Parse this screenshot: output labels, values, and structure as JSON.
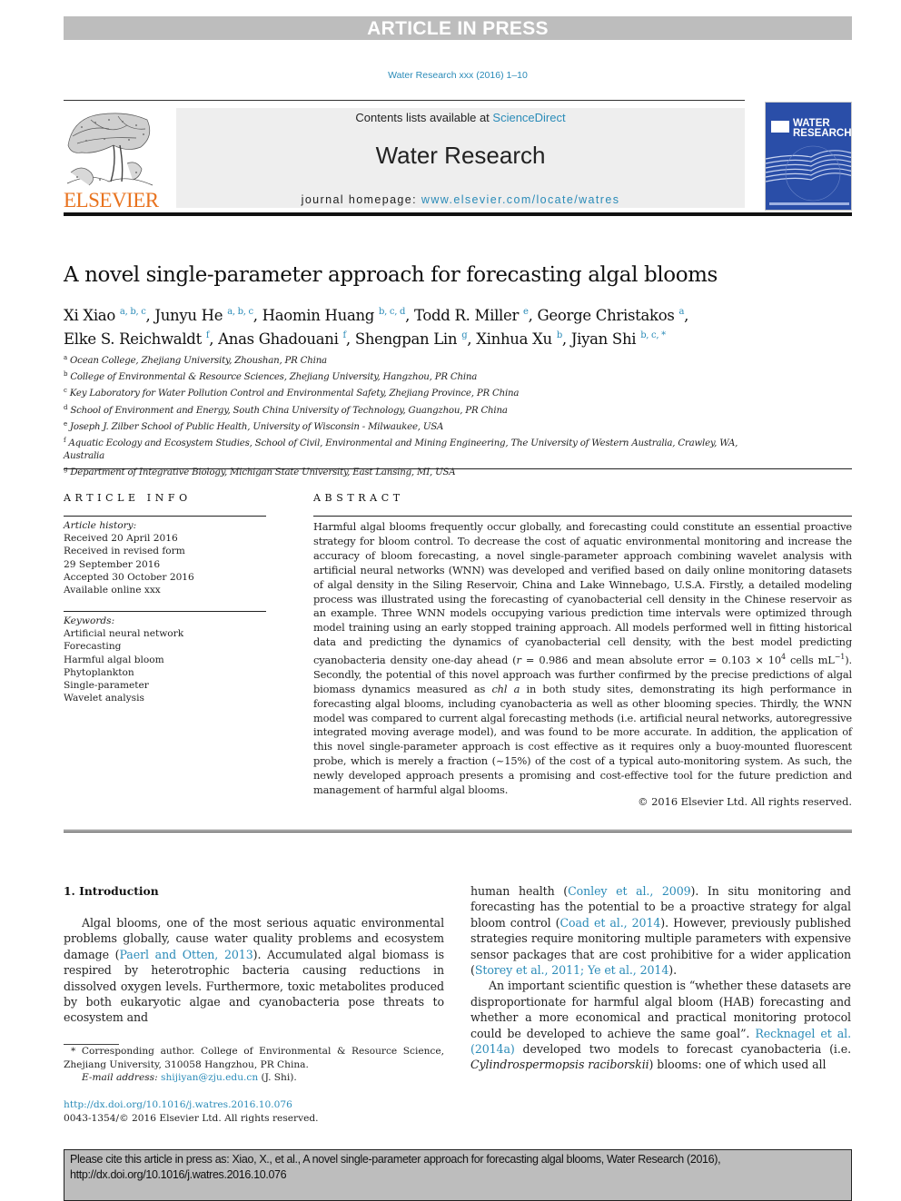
{
  "banner": {
    "text": "ARTICLE IN PRESS"
  },
  "journal_citation": "Water Research xxx (2016) 1–10",
  "masthead": {
    "publisher_logo_text": "ELSEVIER",
    "contents_prefix": "Contents lists available at ",
    "contents_link": "ScienceDirect",
    "journal_name": "Water Research",
    "homepage_prefix": "journal homepage: ",
    "homepage_link": "www.elsevier.com/locate/watres",
    "cover_title_line1": "WATER",
    "cover_title_line2": "RESEARCH"
  },
  "article": {
    "title": "A novel single-parameter approach for forecasting algal blooms",
    "authors": [
      {
        "name": "Xi Xiao",
        "sup": "a, b, c"
      },
      {
        "name": "Junyu He",
        "sup": "a, b, c"
      },
      {
        "name": "Haomin Huang",
        "sup": "b, c, d"
      },
      {
        "name": "Todd R. Miller",
        "sup": "e"
      },
      {
        "name": "George Christakos",
        "sup": "a"
      },
      {
        "name": "Elke S. Reichwaldt",
        "sup": "f"
      },
      {
        "name": "Anas Ghadouani",
        "sup": "f"
      },
      {
        "name": "Shengpan Lin",
        "sup": "g"
      },
      {
        "name": "Xinhua Xu",
        "sup": "b"
      },
      {
        "name": "Jiyan Shi",
        "sup": "b, c, *"
      }
    ],
    "affiliations": [
      {
        "key": "a",
        "text": "Ocean College, Zhejiang University, Zhoushan, PR China"
      },
      {
        "key": "b",
        "text": "College of Environmental & Resource Sciences, Zhejiang University, Hangzhou, PR China"
      },
      {
        "key": "c",
        "text": "Key Laboratory for Water Pollution Control and Environmental Safety, Zhejiang Province, PR China"
      },
      {
        "key": "d",
        "text": "School of Environment and Energy, South China University of Technology, Guangzhou, PR China"
      },
      {
        "key": "e",
        "text": "Joseph J. Zilber School of Public Health, University of Wisconsin - Milwaukee, USA"
      },
      {
        "key": "f",
        "text": "Aquatic Ecology and Ecosystem Studies, School of Civil, Environmental and Mining Engineering, The University of Western Australia, Crawley, WA, Australia"
      },
      {
        "key": "g",
        "text": "Department of Integrative Biology, Michigan State University, East Lansing, MI, USA"
      }
    ]
  },
  "article_info": {
    "heading": "ARTICLE INFO",
    "history_label": "Article history:",
    "history": [
      "Received 20 April 2016",
      "Received in revised form",
      "29 September 2016",
      "Accepted 30 October 2016",
      "Available online xxx"
    ],
    "keywords_label": "Keywords:",
    "keywords": [
      "Artificial neural network",
      "Forecasting",
      "Harmful algal bloom",
      "Phytoplankton",
      "Single-parameter",
      "Wavelet analysis"
    ]
  },
  "abstract": {
    "heading": "ABSTRACT",
    "part1": "Harmful algal blooms frequently occur globally, and forecasting could constitute an essential proactive strategy for bloom control. To decrease the cost of aquatic environmental monitoring and increase the accuracy of bloom forecasting, a novel single-parameter approach combining wavelet analysis with artificial neural networks (WNN) was developed and verified based on daily online monitoring datasets of algal density in the Siling Reservoir, China and Lake Winnebago, U.S.A. Firstly, a detailed modeling process was illustrated using the forecasting of cyanobacterial cell density in the Chinese reservoir as an example. Three WNN models occupying various prediction time intervals were optimized through model training using an early stopped training approach. All models performed well in fitting historical data and predicting the dynamics of cyanobacterial cell density, with the best model predicting cyanobacteria density one-day ahead (",
    "r_symbol": "r",
    "part2": " = 0.986 and mean absolute error = 0.103 × 10",
    "exp1": "4",
    "part3": " cells mL",
    "exp2": "−1",
    "part4": "). Secondly, the potential of this novel approach was further confirmed by the precise predictions of algal biomass dynamics measured as ",
    "chl": "chl a",
    "part5": " in both study sites, demonstrating its high performance in forecasting algal blooms, including cyanobacteria as well as other blooming species. Thirdly, the WNN model was compared to current algal forecasting methods (i.e. artificial neural networks, autoregressive integrated moving average model), and was found to be more accurate. In addition, the application of this novel single-parameter approach is cost effective as it requires only a buoy-mounted fluorescent probe, which is merely a fraction (~15%) of the cost of a typical auto-monitoring system. As such, the newly developed approach presents a promising and cost-effective tool for the future prediction and management of harmful algal blooms.",
    "copyright": "© 2016 Elsevier Ltd. All rights reserved."
  },
  "introduction": {
    "heading": "1.  Introduction",
    "p1_a": "Algal blooms, one of the most serious aquatic environmental problems globally, cause water quality problems and ecosystem damage (",
    "p1_ref1": "Paerl and Otten, 2013",
    "p1_b": "). Accumulated algal biomass is respired by heterotrophic bacteria causing reductions in dissolved oxygen levels. Furthermore, toxic metabolites produced by both eukaryotic algae and cyanobacteria pose threats to ecosystem and ",
    "p1_c": "human health (",
    "p1_ref2": "Conley et al., 2009",
    "p1_d": "). In situ monitoring and forecasting has the potential to be a proactive strategy for algal bloom control (",
    "p1_ref3": "Coad et al., 2014",
    "p1_e": "). However, previously published strategies require monitoring multiple parameters with expensive sensor packages that are cost prohibitive for a wider application (",
    "p1_ref4": "Storey et al., 2011; Ye et al., 2014",
    "p1_f": ").",
    "p2_a": "An important scientific question is “whether these datasets are disproportionate for harmful algal bloom (HAB) forecasting and whether a more economical and practical monitoring protocol could be developed to achieve the same goal”. ",
    "p2_ref1": "Recknagel et al. (2014a)",
    "p2_b": " developed two models to forecast cyanobacteria (i.e. ",
    "p2_species": "Cylindrospermopsis raciborskii",
    "p2_c": ") blooms: one of which used all"
  },
  "footnotes": {
    "corresponding": "* Corresponding author. College of Environmental & Resource Science, Zhejiang University, 310058 Hangzhou, PR China.",
    "email_label": "E-mail address: ",
    "email": "shijiyan@zju.edu.cn",
    "email_suffix": " (J. Shi).",
    "doi": "http://dx.doi.org/10.1016/j.watres.2016.10.076",
    "issn": "0043-1354/© 2016 Elsevier Ltd. All rights reserved."
  },
  "cite_box": {
    "text": "Please cite this article in press as: Xiao, X., et al., A novel single-parameter approach for forecasting algal blooms, Water Research (2016), http://dx.doi.org/10.1016/j.watres.2016.10.076"
  }
}
